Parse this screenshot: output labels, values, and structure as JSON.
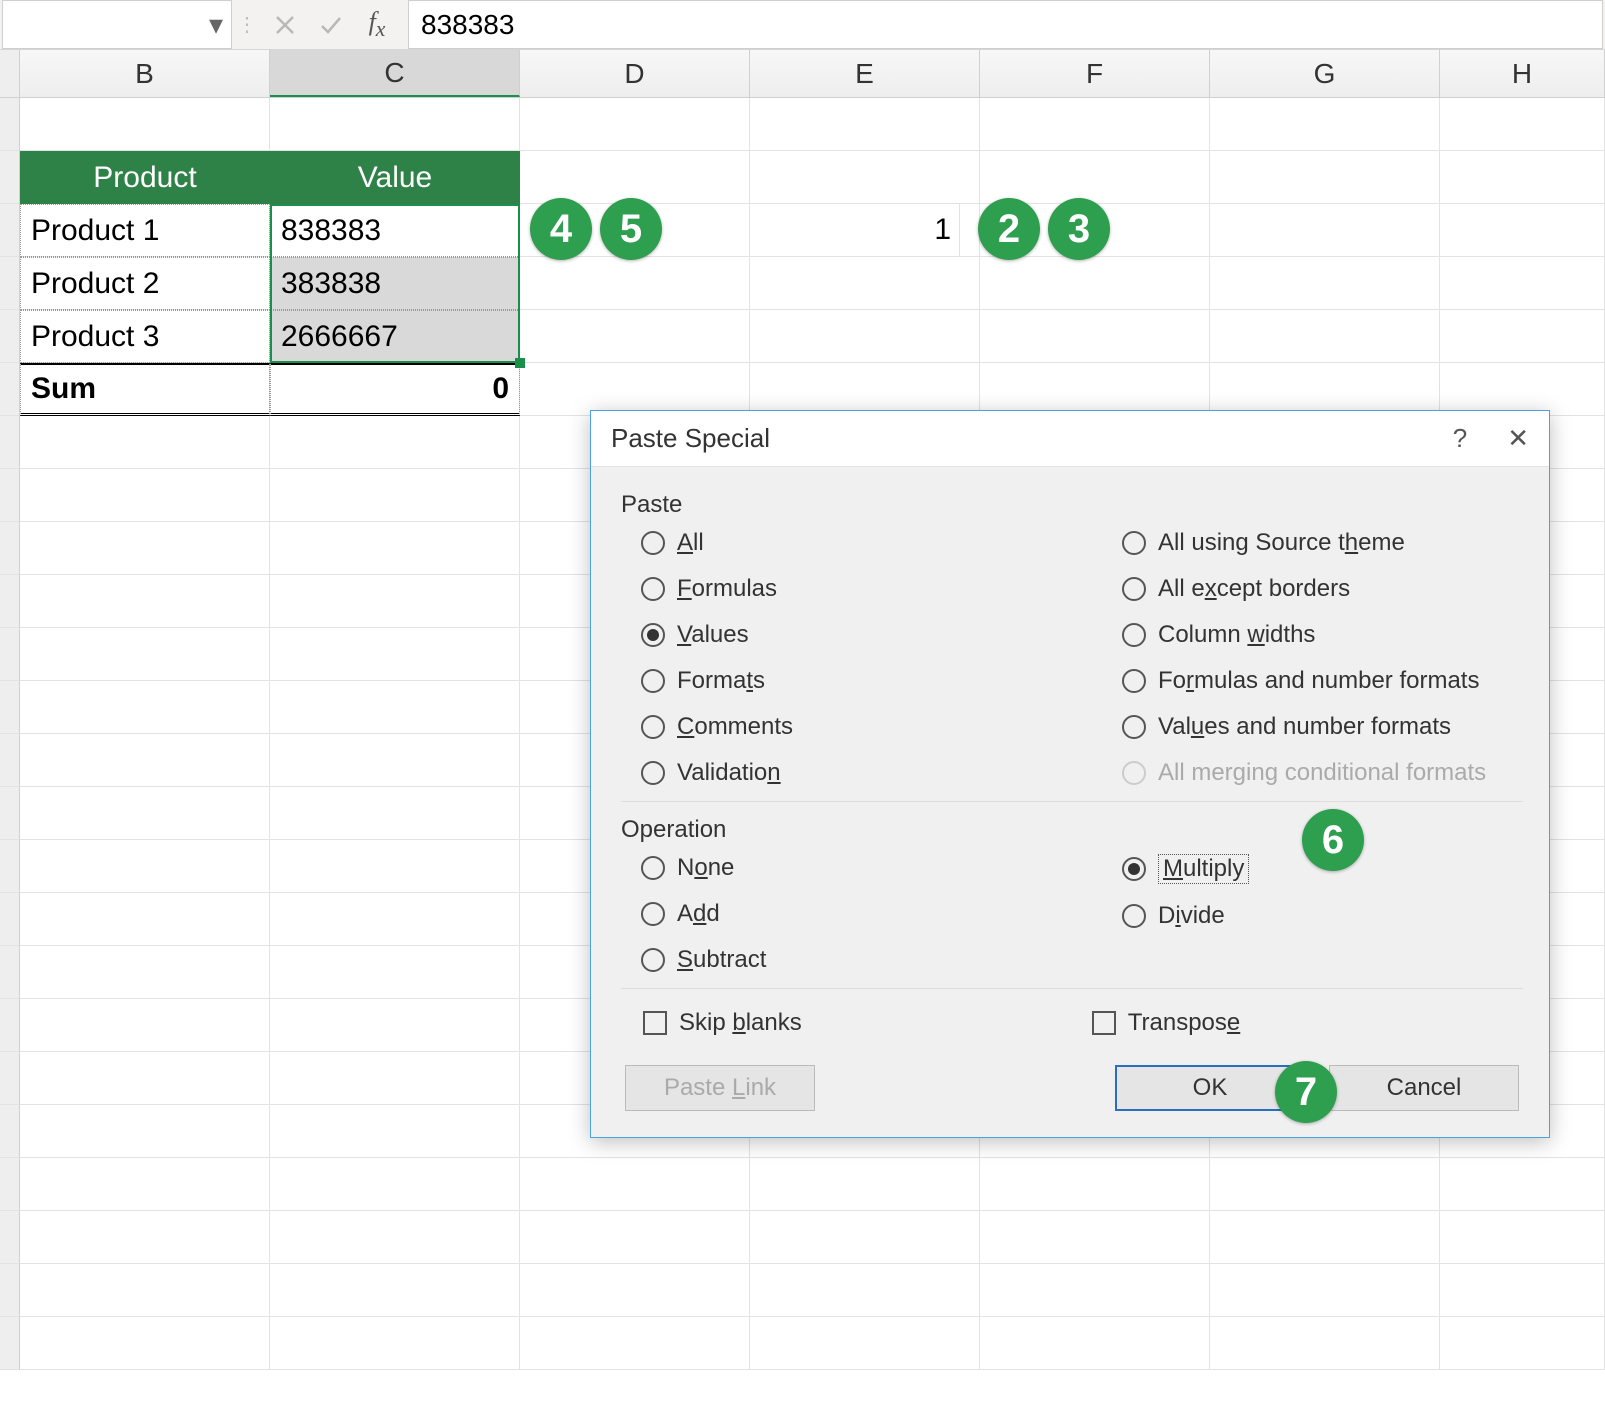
{
  "formula_bar": {
    "name_box": "",
    "value": "838383"
  },
  "columns": [
    "B",
    "C",
    "D",
    "E",
    "F",
    "G",
    "H"
  ],
  "active_column": "C",
  "table": {
    "headers": {
      "product": "Product",
      "value": "Value"
    },
    "rows": [
      {
        "product": "Product 1",
        "value": "838383"
      },
      {
        "product": "Product 2",
        "value": "383838"
      },
      {
        "product": "Product 3",
        "value": "2666667"
      }
    ],
    "sum_label": "Sum",
    "sum_value": "0"
  },
  "cell_e3": "1",
  "badges": {
    "b2": "2",
    "b3": "3",
    "b4": "4",
    "b5": "5",
    "b6": "6",
    "b7": "7"
  },
  "dialog": {
    "title": "Paste Special",
    "help": "?",
    "sections": {
      "paste": "Paste",
      "operation": "Operation"
    },
    "paste_left": [
      {
        "key": "all",
        "pre": "",
        "u": "A",
        "post": "ll"
      },
      {
        "key": "formulas",
        "pre": "",
        "u": "F",
        "post": "ormulas"
      },
      {
        "key": "values",
        "pre": "",
        "u": "V",
        "post": "alues"
      },
      {
        "key": "formats",
        "pre": "Forma",
        "u": "t",
        "post": "s"
      },
      {
        "key": "comments",
        "pre": "",
        "u": "C",
        "post": "omments"
      },
      {
        "key": "validation",
        "pre": "Validatio",
        "u": "n",
        "post": ""
      }
    ],
    "paste_right": [
      {
        "key": "source_theme",
        "pre": "All using Source t",
        "u": "h",
        "post": "eme"
      },
      {
        "key": "except_borders",
        "pre": "All e",
        "u": "x",
        "post": "cept borders"
      },
      {
        "key": "col_widths",
        "pre": "Column ",
        "u": "w",
        "post": "idths"
      },
      {
        "key": "form_num",
        "pre": "Fo",
        "u": "r",
        "post": "mulas and number formats"
      },
      {
        "key": "val_num",
        "pre": "Val",
        "u": "u",
        "post": "es and number formats"
      },
      {
        "key": "cond_fmt",
        "pre": "All mer",
        "u": "g",
        "post": "ing conditional formats"
      }
    ],
    "paste_selected": "values",
    "paste_disabled": [
      "cond_fmt"
    ],
    "op_left": [
      {
        "key": "none",
        "pre": "N",
        "u": "o",
        "post": "ne"
      },
      {
        "key": "add",
        "pre": "A",
        "u": "d",
        "post": "d"
      },
      {
        "key": "subtract",
        "pre": "",
        "u": "S",
        "post": "ubtract"
      }
    ],
    "op_right": [
      {
        "key": "multiply",
        "pre": "",
        "u": "M",
        "post": "ultiply"
      },
      {
        "key": "divide",
        "pre": "D",
        "u": "i",
        "post": "vide"
      }
    ],
    "op_selected": "multiply",
    "skip_blanks_pre": "Skip ",
    "skip_blanks_u": "b",
    "skip_blanks_post": "lanks",
    "transpose_pre": "Transpos",
    "transpose_u": "e",
    "transpose_post": "",
    "paste_link_pre": "Paste ",
    "paste_link_u": "L",
    "paste_link_post": "ink",
    "ok": "OK",
    "cancel": "Cancel"
  }
}
